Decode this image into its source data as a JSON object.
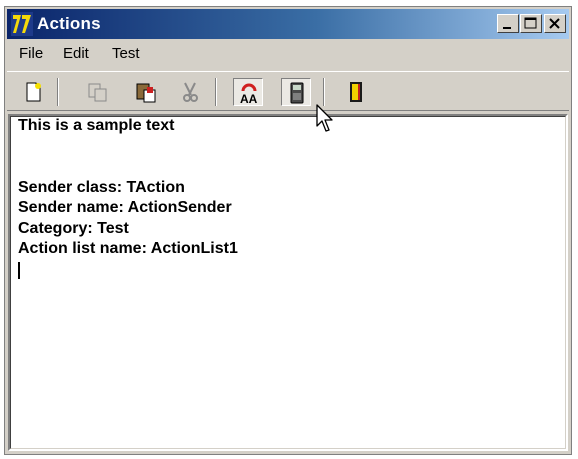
{
  "window": {
    "title": "Actions"
  },
  "title_buttons": [
    {
      "name": "minimize-button",
      "icon": "minimize-icon"
    },
    {
      "name": "maximize-button",
      "icon": "maximize-icon"
    },
    {
      "name": "close-button",
      "icon": "close-icon"
    }
  ],
  "menu": {
    "items": [
      "File",
      "Edit",
      "Test"
    ]
  },
  "toolbar": {
    "buttons": [
      {
        "icon": "new-file-icon",
        "enabled": true,
        "pressed": false
      },
      {
        "icon": "copy-icon",
        "enabled": false,
        "pressed": false
      },
      {
        "icon": "paste-icon",
        "enabled": true,
        "pressed": false
      },
      {
        "icon": "cut-icon",
        "enabled": false,
        "pressed": false
      },
      {
        "icon": "font-icon",
        "enabled": true,
        "pressed": true
      },
      {
        "icon": "calculator-icon",
        "enabled": true,
        "pressed": true
      },
      {
        "icon": "exit-door-icon",
        "enabled": true,
        "pressed": false
      }
    ]
  },
  "memo": {
    "lines": [
      "This is a sample text",
      "",
      "",
      "Sender class: TAction",
      "Sender name: ActionSender",
      "Category: Test",
      "Action list name: ActionList1"
    ]
  }
}
